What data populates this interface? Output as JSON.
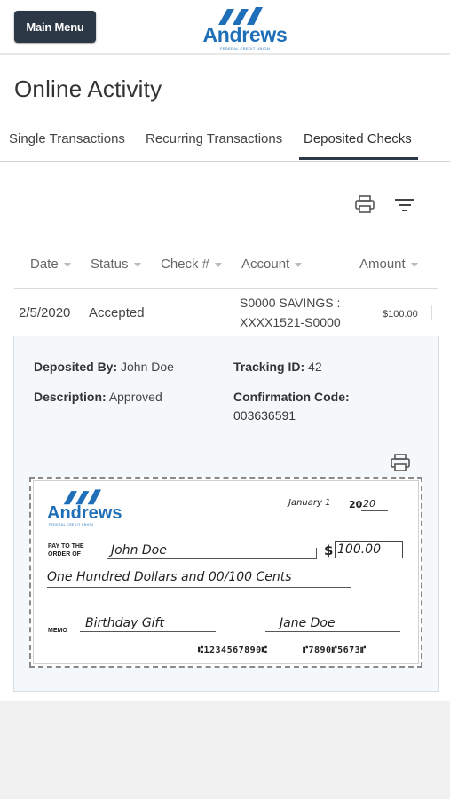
{
  "header": {
    "menu_button": "Main Menu",
    "logo_text": "Andrews",
    "logo_sub": "FEDERAL CREDIT UNION"
  },
  "page": {
    "title": "Online Activity"
  },
  "tabs": [
    {
      "label": "Single Transactions",
      "active": false
    },
    {
      "label": "Recurring Transactions",
      "active": false
    },
    {
      "label": "Deposited Checks",
      "active": true
    }
  ],
  "toolbar": {
    "print_icon": "printer-icon",
    "filter_icon": "filter-icon"
  },
  "table": {
    "columns": [
      "Date",
      "Status",
      "Check #",
      "Account",
      "Amount"
    ],
    "rows": [
      {
        "date": "2/5/2020",
        "status": "Accepted",
        "check_no": "",
        "account_line1": "S0000 SAVINGS :",
        "account_line2": "XXXX1521-S0000",
        "amount": "$100.00"
      }
    ]
  },
  "details": {
    "deposited_by_label": "Deposited By:",
    "deposited_by": "John Doe",
    "tracking_id_label": "Tracking ID:",
    "tracking_id": "42",
    "description_label": "Description:",
    "description": "Approved",
    "confirmation_label": "Confirmation Code:",
    "confirmation_code": "003636591",
    "print_icon": "printer-icon"
  },
  "check": {
    "logo_text": "Andrews",
    "logo_sub": "FEDERAL CREDIT UNION",
    "date": "January 1",
    "year_prefix": "20",
    "year_suffix": "20",
    "pay_to_label_1": "PAY TO THE",
    "pay_to_label_2": "ORDER OF",
    "payee": "John Doe",
    "dollar_sign": "$",
    "amount": "100.00",
    "amount_words": "One Hundred Dollars and 00/100 Cents",
    "memo_label": "MEMO",
    "memo": "Birthday Gift",
    "signature": "Jane Doe",
    "micr_routing": "⑆1234567890⑆",
    "micr_account": "⑈7890⑈5673⑈"
  },
  "colors": {
    "brand_blue": "#1e6fb8",
    "menu_button_bg": "#2d3846",
    "panel_bg": "#f5f8fb"
  }
}
